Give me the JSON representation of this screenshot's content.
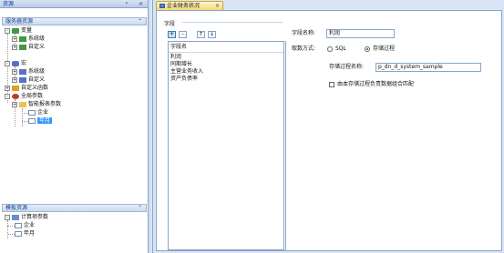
{
  "left_panel": {
    "title": "资源",
    "pin_glyph": "ᵖ",
    "close_glyph": "×",
    "server_section": {
      "title": "服务器资源",
      "nodes": [
        {
          "label": "变量",
          "icon": "variable-icon",
          "expander": "-"
        },
        {
          "label": "系统级",
          "icon": "folder-icon",
          "expander": "+"
        },
        {
          "label": "自定义",
          "icon": "folder-icon",
          "expander": "+"
        },
        {
          "label": "宏",
          "icon": "macro-icon",
          "expander": "-"
        },
        {
          "label": "系统级",
          "icon": "folder-icon",
          "expander": "+"
        },
        {
          "label": "自定义",
          "icon": "folder-icon",
          "expander": "+"
        },
        {
          "label": "自定义函数",
          "icon": "function-icon",
          "expander": "+"
        },
        {
          "label": "全局参数",
          "icon": "parameter-icon",
          "expander": "-"
        },
        {
          "label": "智能报表参数",
          "icon": "folder-icon",
          "expander": "+"
        },
        {
          "label": "企业",
          "icon": "param-item-icon",
          "expander": ""
        },
        {
          "label": "年月",
          "icon": "param-item-icon",
          "expander": "",
          "selected": true
        }
      ]
    },
    "template_section": {
      "title": "模板资源",
      "nodes": [
        {
          "label": "计算项参数",
          "icon": "calc-param-icon",
          "expander": "-"
        },
        {
          "label": "企业",
          "icon": "param-item-icon",
          "expander": ""
        },
        {
          "label": "年月",
          "icon": "param-item-icon",
          "expander": ""
        }
      ]
    },
    "collapse_glyph": "⌃"
  },
  "tab": {
    "label": "企业财务状况",
    "close_glyph": "×"
  },
  "fields_group": {
    "title": "字段",
    "toolbar": {
      "add": "+",
      "remove": "-",
      "up": "↑",
      "down": "↓"
    },
    "list_header": "字段名",
    "items": [
      "利润",
      "同期增长",
      "主营业务收入",
      "资产负债率"
    ]
  },
  "form": {
    "field_name_label": "字段名称:",
    "field_name_value": "利润",
    "fetch_mode_label": "取数方式:",
    "option_sql": "SQL",
    "option_procedure": "存储过程",
    "selected_option": "存储过程",
    "procedure_name_label": "存储过程名称:",
    "procedure_name_value": "p_dn_d_system_sample",
    "checkbox_label": "由本存储过程负责数据组合匹配",
    "checkbox_checked": false
  },
  "colors": {
    "accent": "#15428b",
    "selection": "#3399ff",
    "tab_active": "#f7d87a"
  }
}
